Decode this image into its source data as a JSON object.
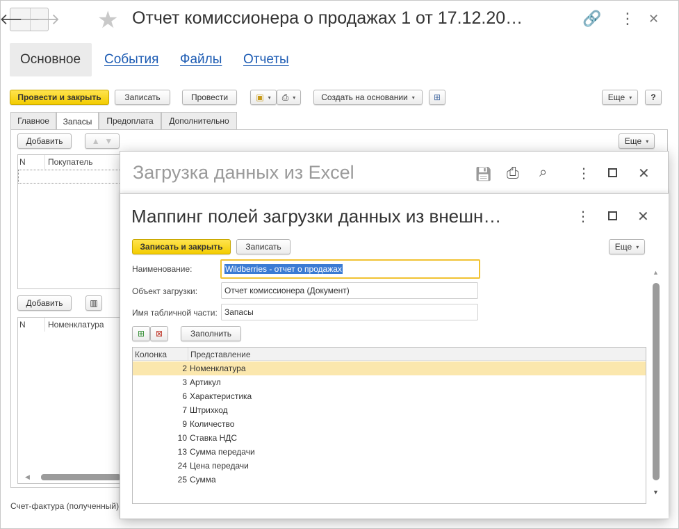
{
  "window": {
    "title": "Отчет комиссионера о продажах 1 от 17.12.20…",
    "icons": {
      "back": "arrow-left-icon",
      "forward": "arrow-right-icon",
      "favorite": "star-icon",
      "link": "link-icon",
      "more": "more-vertical-icon",
      "close": "close-icon"
    },
    "glyphs": {
      "back": "🡐",
      "forward": "🡒",
      "star": "★",
      "link": "🔗",
      "more": "⋮",
      "close": "✕"
    }
  },
  "main_tabs": [
    {
      "label": "Основное",
      "active": true
    },
    {
      "label": "События"
    },
    {
      "label": "Файлы"
    },
    {
      "label": "Отчеты"
    }
  ],
  "toolbar": {
    "post_close": "Провести и закрыть",
    "save": "Записать",
    "post": "Провести",
    "create_based": "Создать на основании",
    "more": "Еще",
    "help": "?"
  },
  "sub_tabs": [
    "Главное",
    "Запасы",
    "Предоплата",
    "Дополнительно"
  ],
  "inventory": {
    "add": "Добавить",
    "more": "Еще",
    "grid1": {
      "col_n": "N",
      "col_buyer": "Покупатель"
    },
    "grid2": {
      "col_n": "N",
      "col_item": "Номенклатура"
    },
    "footer": "Счет-фактура (полученный)"
  },
  "excel_dialog": {
    "title": "Загрузка данных из Excel"
  },
  "mapping_dialog": {
    "title": "Маппинг полей загрузки данных из внешн…",
    "save_close": "Записать и закрыть",
    "save": "Записать",
    "more": "Еще",
    "name_label": "Наименование:",
    "name_value": "Wildberries - отчет о продажах",
    "object_label": "Объект загрузки:",
    "object_value": "Отчет комиссионера (Документ)",
    "tabpart_label": "Имя табличной части:",
    "tabpart_value": "Запасы",
    "fill": "Заполнить",
    "table": {
      "col_column": "Колонка",
      "col_repr": "Представление",
      "rows": [
        {
          "col": "2",
          "repr": "Номенклатура",
          "selected": true
        },
        {
          "col": "3",
          "repr": "Артикул"
        },
        {
          "col": "6",
          "repr": "Характеристика"
        },
        {
          "col": "7",
          "repr": "Штрихкод"
        },
        {
          "col": "9",
          "repr": "Количество"
        },
        {
          "col": "10",
          "repr": "Ставка НДС"
        },
        {
          "col": "13",
          "repr": "Сумма передачи"
        },
        {
          "col": "24",
          "repr": "Цена передачи"
        },
        {
          "col": "25",
          "repr": "Сумма"
        }
      ]
    }
  },
  "colors": {
    "accent": "#f3cc00",
    "link": "#1c5bb3",
    "selection": "#fbe7ad",
    "highlight": "#3b7bd4"
  }
}
